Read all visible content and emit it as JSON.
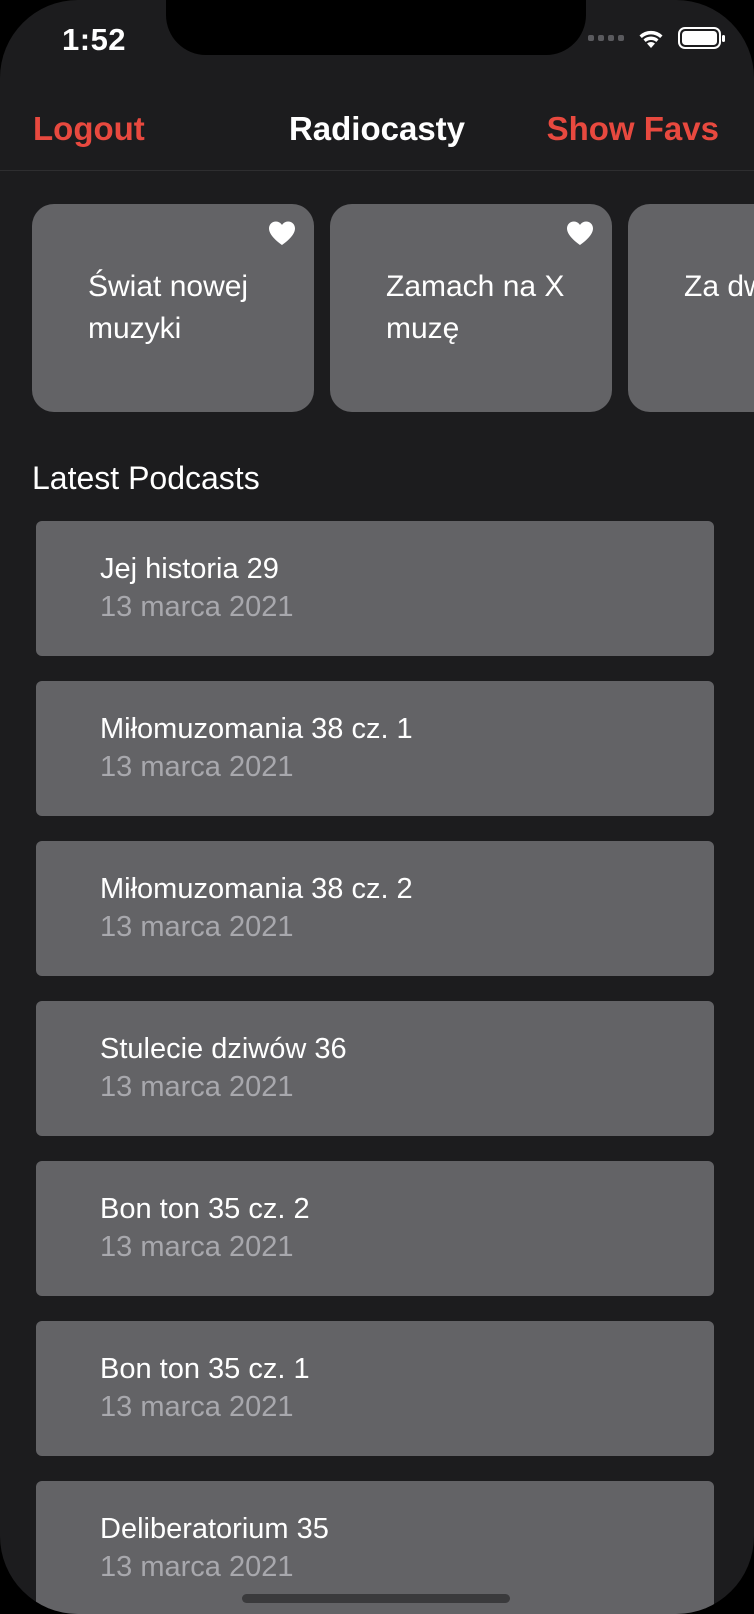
{
  "status_bar": {
    "time": "1:52"
  },
  "navbar": {
    "left_label": "Logout",
    "title": "Radiocasty",
    "right_label": "Show Favs"
  },
  "favorites": [
    {
      "title": "Świat nowej muzyki",
      "favorited": true
    },
    {
      "title": "Zamach na X muzę",
      "favorited": true
    },
    {
      "title": "Za dwa week...",
      "favorited": true
    }
  ],
  "section": {
    "title": "Latest Podcasts"
  },
  "podcasts": [
    {
      "title": "Jej historia 29",
      "date": "13 marca 2021"
    },
    {
      "title": "Miłomuzomania 38 cz. 1",
      "date": "13 marca 2021"
    },
    {
      "title": "Miłomuzomania 38 cz. 2",
      "date": "13 marca 2021"
    },
    {
      "title": "Stulecie dziwów 36",
      "date": "13 marca 2021"
    },
    {
      "title": "Bon ton 35 cz. 2",
      "date": "13 marca 2021"
    },
    {
      "title": "Bon ton 35 cz. 1",
      "date": "13 marca 2021"
    },
    {
      "title": "Deliberatorium 35",
      "date": "13 marca 2021"
    }
  ],
  "colors": {
    "accent": "#e8493f",
    "background": "#1c1c1e",
    "card": "#636366",
    "secondary_text": "#a8a8ad"
  }
}
